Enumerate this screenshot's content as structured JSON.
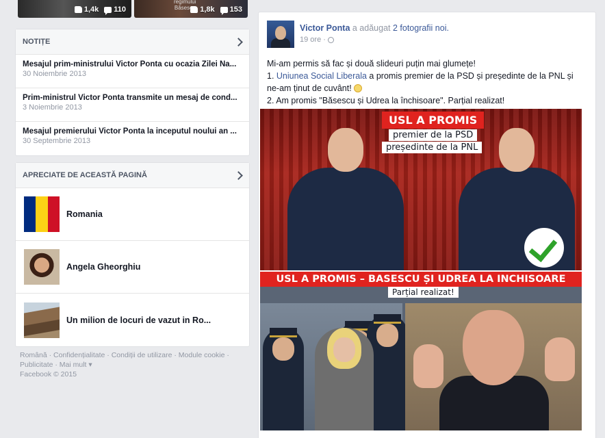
{
  "top_photos": [
    {
      "caption": "",
      "likes": "1,4k",
      "comments": "110"
    },
    {
      "caption": "regimului\nBăsescu",
      "likes": "1,8k",
      "comments": "153"
    }
  ],
  "notes": {
    "title": "NOTIȚE",
    "items": [
      {
        "title": "Mesajul prim-ministrului Victor Ponta cu ocazia Zilei Na...",
        "date": "30 Noiembrie 2013"
      },
      {
        "title": "Prim-ministrul Victor Ponta transmite un mesaj de cond...",
        "date": "3 Noiembrie 2013"
      },
      {
        "title": "Mesajul premierului Victor Ponta la inceputul noului an ...",
        "date": "30 Septembrie 2013"
      }
    ]
  },
  "liked_pages": {
    "title": "APRECIATE DE ACEASTĂ PAGINĂ",
    "items": [
      {
        "name": "Romania",
        "thumb": "romania-flag"
      },
      {
        "name": "Angela Gheorghiu",
        "thumb": "angela-photo"
      },
      {
        "name": "Un milion de locuri de vazut in Ro...",
        "thumb": "rock-photo"
      }
    ]
  },
  "footer": {
    "links": [
      "Română",
      "Confidențialitate",
      "Condiții de utilizare",
      "Module cookie",
      "Publicitate",
      "Mai mult"
    ],
    "copyright": "Facebook © 2015"
  },
  "post": {
    "author": "Victor Ponta",
    "action": " a adăugat ",
    "photos_link": "2 fotografii noi.",
    "time": "19 ore",
    "line1": "Mi-am permis să fac și două slideuri puțin mai glumețe!",
    "line2_prefix": "1. ",
    "line2_link": "Uniunea Social Liberala",
    "line2_rest": " a promis premier de la PSD și președinte de la PNL și ne-am ținut de cuvânt!",
    "line3": "2. Am promis \"Băsescu și Udrea la închisoare\". Parțial realizat!",
    "image1": {
      "headline": "USL A PROMIS",
      "sub1": "premier de la PSD",
      "sub2": "președinte de la PNL"
    },
    "image2": {
      "headline": "USL A PROMIS – BASESCU ȘI UDREA LA INCHISOARE",
      "sub": "Parțial realizat!"
    }
  },
  "colors": {
    "link": "#3b5998",
    "banner_red": "#e0231f",
    "check_green": "#2ea22a",
    "background": "#e9eaed"
  }
}
